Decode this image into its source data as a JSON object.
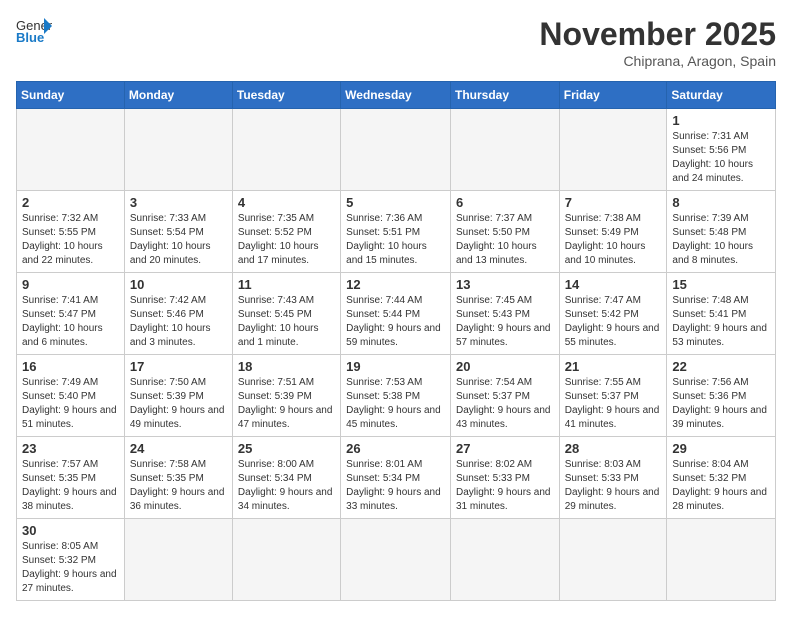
{
  "header": {
    "logo_general": "General",
    "logo_blue": "Blue",
    "month": "November 2025",
    "location": "Chiprana, Aragon, Spain"
  },
  "days_of_week": [
    "Sunday",
    "Monday",
    "Tuesday",
    "Wednesday",
    "Thursday",
    "Friday",
    "Saturday"
  ],
  "weeks": [
    [
      {
        "day": "",
        "info": ""
      },
      {
        "day": "",
        "info": ""
      },
      {
        "day": "",
        "info": ""
      },
      {
        "day": "",
        "info": ""
      },
      {
        "day": "",
        "info": ""
      },
      {
        "day": "",
        "info": ""
      },
      {
        "day": "1",
        "info": "Sunrise: 7:31 AM\nSunset: 5:56 PM\nDaylight: 10 hours and 24 minutes."
      }
    ],
    [
      {
        "day": "2",
        "info": "Sunrise: 7:32 AM\nSunset: 5:55 PM\nDaylight: 10 hours and 22 minutes."
      },
      {
        "day": "3",
        "info": "Sunrise: 7:33 AM\nSunset: 5:54 PM\nDaylight: 10 hours and 20 minutes."
      },
      {
        "day": "4",
        "info": "Sunrise: 7:35 AM\nSunset: 5:52 PM\nDaylight: 10 hours and 17 minutes."
      },
      {
        "day": "5",
        "info": "Sunrise: 7:36 AM\nSunset: 5:51 PM\nDaylight: 10 hours and 15 minutes."
      },
      {
        "day": "6",
        "info": "Sunrise: 7:37 AM\nSunset: 5:50 PM\nDaylight: 10 hours and 13 minutes."
      },
      {
        "day": "7",
        "info": "Sunrise: 7:38 AM\nSunset: 5:49 PM\nDaylight: 10 hours and 10 minutes."
      },
      {
        "day": "8",
        "info": "Sunrise: 7:39 AM\nSunset: 5:48 PM\nDaylight: 10 hours and 8 minutes."
      }
    ],
    [
      {
        "day": "9",
        "info": "Sunrise: 7:41 AM\nSunset: 5:47 PM\nDaylight: 10 hours and 6 minutes."
      },
      {
        "day": "10",
        "info": "Sunrise: 7:42 AM\nSunset: 5:46 PM\nDaylight: 10 hours and 3 minutes."
      },
      {
        "day": "11",
        "info": "Sunrise: 7:43 AM\nSunset: 5:45 PM\nDaylight: 10 hours and 1 minute."
      },
      {
        "day": "12",
        "info": "Sunrise: 7:44 AM\nSunset: 5:44 PM\nDaylight: 9 hours and 59 minutes."
      },
      {
        "day": "13",
        "info": "Sunrise: 7:45 AM\nSunset: 5:43 PM\nDaylight: 9 hours and 57 minutes."
      },
      {
        "day": "14",
        "info": "Sunrise: 7:47 AM\nSunset: 5:42 PM\nDaylight: 9 hours and 55 minutes."
      },
      {
        "day": "15",
        "info": "Sunrise: 7:48 AM\nSunset: 5:41 PM\nDaylight: 9 hours and 53 minutes."
      }
    ],
    [
      {
        "day": "16",
        "info": "Sunrise: 7:49 AM\nSunset: 5:40 PM\nDaylight: 9 hours and 51 minutes."
      },
      {
        "day": "17",
        "info": "Sunrise: 7:50 AM\nSunset: 5:39 PM\nDaylight: 9 hours and 49 minutes."
      },
      {
        "day": "18",
        "info": "Sunrise: 7:51 AM\nSunset: 5:39 PM\nDaylight: 9 hours and 47 minutes."
      },
      {
        "day": "19",
        "info": "Sunrise: 7:53 AM\nSunset: 5:38 PM\nDaylight: 9 hours and 45 minutes."
      },
      {
        "day": "20",
        "info": "Sunrise: 7:54 AM\nSunset: 5:37 PM\nDaylight: 9 hours and 43 minutes."
      },
      {
        "day": "21",
        "info": "Sunrise: 7:55 AM\nSunset: 5:37 PM\nDaylight: 9 hours and 41 minutes."
      },
      {
        "day": "22",
        "info": "Sunrise: 7:56 AM\nSunset: 5:36 PM\nDaylight: 9 hours and 39 minutes."
      }
    ],
    [
      {
        "day": "23",
        "info": "Sunrise: 7:57 AM\nSunset: 5:35 PM\nDaylight: 9 hours and 38 minutes."
      },
      {
        "day": "24",
        "info": "Sunrise: 7:58 AM\nSunset: 5:35 PM\nDaylight: 9 hours and 36 minutes."
      },
      {
        "day": "25",
        "info": "Sunrise: 8:00 AM\nSunset: 5:34 PM\nDaylight: 9 hours and 34 minutes."
      },
      {
        "day": "26",
        "info": "Sunrise: 8:01 AM\nSunset: 5:34 PM\nDaylight: 9 hours and 33 minutes."
      },
      {
        "day": "27",
        "info": "Sunrise: 8:02 AM\nSunset: 5:33 PM\nDaylight: 9 hours and 31 minutes."
      },
      {
        "day": "28",
        "info": "Sunrise: 8:03 AM\nSunset: 5:33 PM\nDaylight: 9 hours and 29 minutes."
      },
      {
        "day": "29",
        "info": "Sunrise: 8:04 AM\nSunset: 5:32 PM\nDaylight: 9 hours and 28 minutes."
      }
    ],
    [
      {
        "day": "30",
        "info": "Sunrise: 8:05 AM\nSunset: 5:32 PM\nDaylight: 9 hours and 27 minutes."
      },
      {
        "day": "",
        "info": ""
      },
      {
        "day": "",
        "info": ""
      },
      {
        "day": "",
        "info": ""
      },
      {
        "day": "",
        "info": ""
      },
      {
        "day": "",
        "info": ""
      },
      {
        "day": "",
        "info": ""
      }
    ]
  ]
}
